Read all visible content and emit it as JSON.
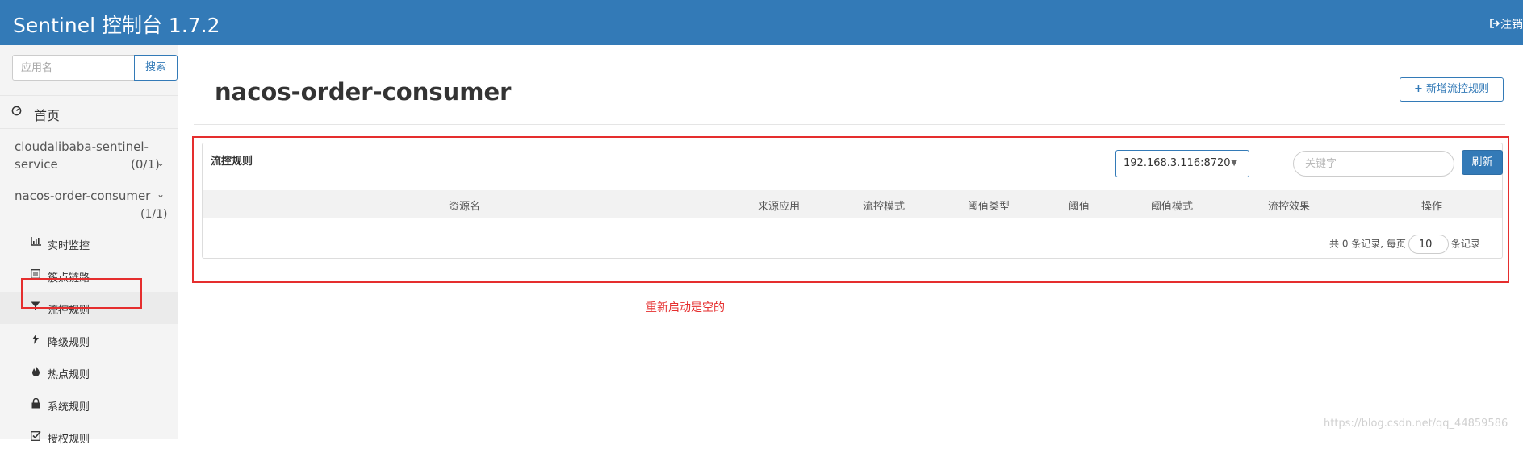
{
  "header": {
    "title": "Sentinel 控制台 1.7.2",
    "logout_label": "注销"
  },
  "sidebar": {
    "search_placeholder": "应用名",
    "search_button": "搜索",
    "home_label": "首页",
    "apps": [
      {
        "name": "cloudalibaba-sentinel-service",
        "count": "(0/1)"
      },
      {
        "name": "nacos-order-consumer",
        "count": "(1/1)"
      }
    ],
    "menu": [
      {
        "label": "实时监控",
        "icon": "bar-chart-icon"
      },
      {
        "label": "簇点链路",
        "icon": "list-icon"
      },
      {
        "label": "流控规则",
        "icon": "filter-icon"
      },
      {
        "label": "降级规则",
        "icon": "flash-icon"
      },
      {
        "label": "热点规则",
        "icon": "fire-icon"
      },
      {
        "label": "系统规则",
        "icon": "lock-icon"
      },
      {
        "label": "授权规则",
        "icon": "check-square-icon"
      }
    ]
  },
  "main": {
    "title": "nacos-order-consumer",
    "add_button": "新增流控规则",
    "panel_title": "流控规则",
    "machine_selected": "192.168.3.116:8720",
    "keyword_placeholder": "关键字",
    "refresh_button": "刷新",
    "columns": [
      "资源名",
      "来源应用",
      "流控模式",
      "阈值类型",
      "阈值",
      "阈值模式",
      "流控效果",
      "操作"
    ],
    "pager": {
      "prefix": "共 0 条记录, 每页",
      "page_size": "10",
      "suffix": "条记录"
    },
    "annotation": "重新启动是空的"
  },
  "watermark": "https://blog.csdn.net/qq_44859586",
  "colors": {
    "header": "#337ab7",
    "highlight": "#e52e2e"
  }
}
